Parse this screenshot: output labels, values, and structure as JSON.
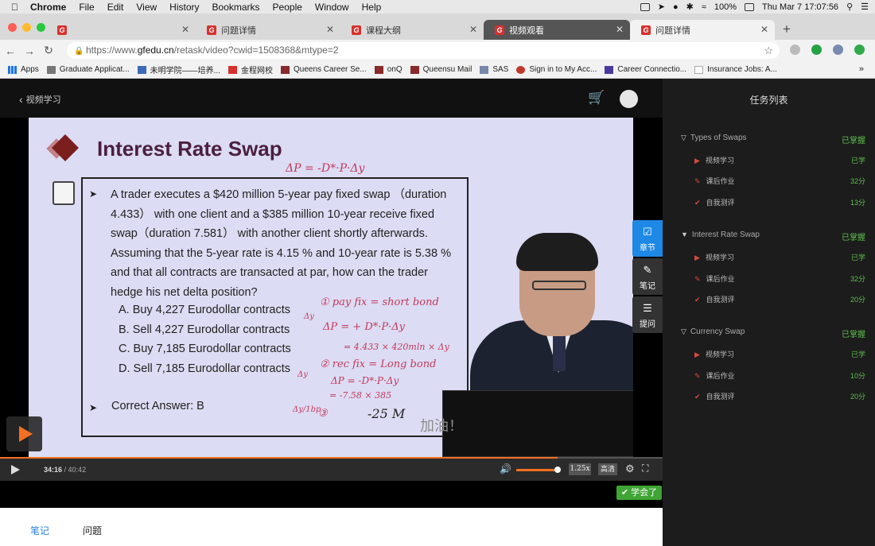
{
  "menubar": {
    "app": "Chrome",
    "items": [
      "File",
      "Edit",
      "View",
      "History",
      "Bookmarks",
      "People",
      "Window",
      "Help"
    ],
    "battery": "100%",
    "datetime": "Thu Mar 7  17:07:56"
  },
  "tabs": [
    {
      "label": "",
      "state": "normal"
    },
    {
      "label": "问题详情",
      "state": "normal"
    },
    {
      "label": "课程大纲",
      "state": "normal"
    },
    {
      "label": "视频观看",
      "state": "dark"
    },
    {
      "label": "问题详情",
      "state": "active"
    }
  ],
  "address": {
    "prefix": "https://www.",
    "host": "gfedu.cn",
    "path": "/retask/video?cwid=1508368&mtype=2"
  },
  "bookmarks": [
    "Apps",
    "Graduate Applicat...",
    "未明学院——培养...",
    "金程网校",
    "Queens Career Se...",
    "onQ",
    "Queensu Mail",
    "SAS",
    "Sign in to My Acc...",
    "Career Connectio...",
    "Insurance Jobs: A..."
  ],
  "header": {
    "back_label": "视频学习"
  },
  "sidebar": {
    "title": "任务列表",
    "chapters": [
      {
        "name": "Types of Swaps",
        "status": "已掌握",
        "tasks": [
          {
            "name": "视频学习",
            "status": "已学"
          },
          {
            "name": "课后作业",
            "status": "32分"
          },
          {
            "name": "自我测评",
            "status": "13分"
          }
        ]
      },
      {
        "name": "Interest Rate Swap",
        "status": "已掌握",
        "tasks": [
          {
            "name": "视频学习",
            "status": "已学"
          },
          {
            "name": "课后作业",
            "status": "32分"
          },
          {
            "name": "自我测评",
            "status": "20分"
          }
        ]
      },
      {
        "name": "Currency Swap",
        "status": "已掌握",
        "tasks": [
          {
            "name": "视频学习",
            "status": "已学"
          },
          {
            "name": "课后作业",
            "status": "10分"
          },
          {
            "name": "自我测评",
            "status": "20分"
          }
        ]
      }
    ]
  },
  "slide": {
    "title": "Interest Rate Swap",
    "question": "A trader executes a $420 million 5-year pay fixed swap （duration 4.433） with one client and a $385 million 10-year receive fixed swap（duration 7.581） with another client shortly afterwards. Assuming that the 5-year rate is 4.15 % and 10-year rate is 5.38 % and that all contracts are transacted at par, how can the trader hedge his net delta position?",
    "options": [
      "A.  Buy 4,227 Eurodollar contracts",
      "B.  Sell 4,227 Eurodollar contracts",
      "C.  Buy 7,185 Eurodollar contracts",
      "D.  Sell 7,185 Eurodollar contracts"
    ],
    "answer": "Correct Answer: B",
    "handwriting": [
      "ΔP = -D*·P·Δy",
      "① pay fix = short bond",
      "ΔP = + D*·P·Δy",
      "= 4.433 × 420mln × Δy",
      "② rec fix = Long bond",
      "ΔP = -D*·P·Δy",
      "= -7.58 × 385",
      "③",
      "-25 M",
      "Δy",
      "Δy",
      "Δy",
      "Δy/1bp"
    ],
    "subtitle": "加油！"
  },
  "float_buttons": [
    {
      "icon": "check-icon",
      "label": "章节"
    },
    {
      "icon": "pencil-icon",
      "label": "笔记"
    },
    {
      "icon": "database-icon",
      "label": "提问"
    }
  ],
  "player": {
    "current": "34:16",
    "sep": " / ",
    "duration": "40:42",
    "progress": 0.842,
    "volume": 0.95,
    "speed": "1.25x",
    "quality": "高清"
  },
  "learned_label": "✔ 学会了",
  "bottom_tabs": [
    "笔记",
    "问题"
  ]
}
